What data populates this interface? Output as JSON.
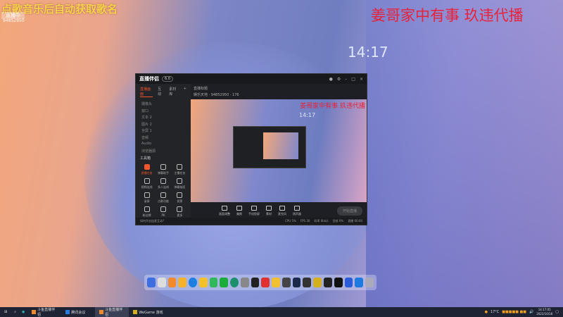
{
  "overlay": {
    "song_hint": "点歌音乐后自动获取歌名",
    "badge": "直播中",
    "room_id": "94852950",
    "notice": "姜哥家中有事 玖违代播",
    "clock": "14:17"
  },
  "app": {
    "title": "直播伴侣",
    "version": "6.0",
    "tabs": [
      "直播画面",
      "互动",
      "素材库"
    ],
    "sources": [
      "摄像头",
      "窗口",
      "文本 2",
      "图片 2",
      "全屏 1",
      "音频",
      "Audio",
      "浏览器源"
    ],
    "tools_heading": "工具箱",
    "tools": [
      "直播任务",
      "弹幕助手",
      "主播任务",
      "视频连线",
      "多人连线",
      "弹幕抽奖",
      "录屏",
      "点歌功能",
      "投票",
      "粉丝牌",
      "PK",
      "更多"
    ],
    "stream_title": "直播标题",
    "category": "娱乐天地",
    "room_id": "94852950",
    "viewers": "176",
    "preview_notice": "姜哥家中有事 玖违代播",
    "preview_clock": "14:17",
    "controls": [
      "画面调整",
      "美颜",
      "手机投屏",
      "素材",
      "麦克风",
      "扬声器"
    ],
    "start_button": "开始直播",
    "status_hint": "如何开启连麦互动?",
    "status_items": [
      "CPU 5%",
      "FPS 30",
      "码率 0kb/s",
      "丢帧 0%",
      "直播 00:00"
    ]
  },
  "taskbar": {
    "apps": [
      "斗鱼直播伴侣",
      "腾讯会议",
      "斗鱼直播伴侣",
      "WeGame 游戏"
    ],
    "temperature": "17°C",
    "time": "14:17:05",
    "date": "2022/10/18"
  }
}
